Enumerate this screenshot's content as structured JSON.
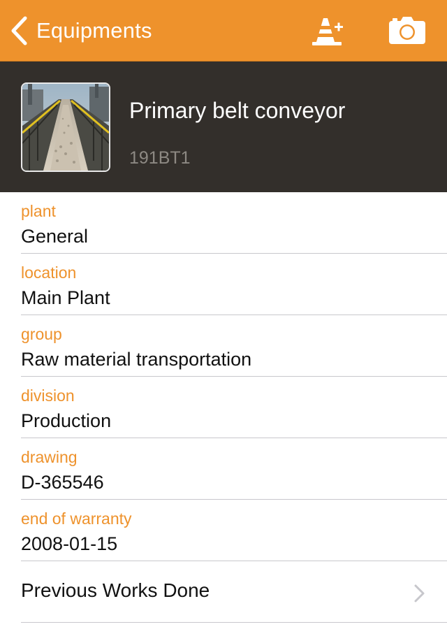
{
  "navbar": {
    "back_label": "Equipments",
    "add_warning_icon": "traffic-cone-plus-icon",
    "camera_icon": "camera-icon",
    "background_color": "#ee922c"
  },
  "equipment": {
    "name": "Primary belt conveyor",
    "code": "191BT1",
    "photo": "conveyor-belt-photo"
  },
  "fields": [
    {
      "label": "plant",
      "value": "General"
    },
    {
      "label": "location",
      "value": "Main Plant"
    },
    {
      "label": "group",
      "value": "Raw material transportation"
    },
    {
      "label": "division",
      "value": "Production"
    },
    {
      "label": "drawing",
      "value": "D-365546"
    },
    {
      "label": "end of warranty",
      "value": "2008-01-15"
    }
  ],
  "previous_works": {
    "label": "Previous Works Done",
    "icon": "chevron-right-icon"
  },
  "colors": {
    "accent": "#ee922c",
    "header_bg": "#332f2b",
    "separator": "#c8c7cc"
  }
}
